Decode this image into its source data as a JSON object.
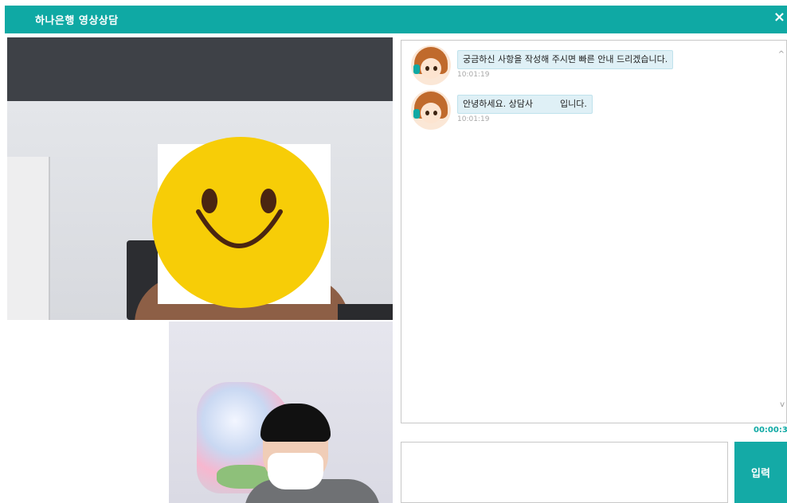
{
  "window": {
    "title": "하나은행 영상상담",
    "close_glyph": "×",
    "accent_color": "#0fa9a4"
  },
  "videos": {
    "remote_label": "",
    "local_label": ""
  },
  "chat": {
    "messages": [
      {
        "sender": "counselor",
        "text_before": "궁금하신 사항을 작성해 주시면 빠른 안내 드리겠습니다.",
        "text_after": "",
        "time": "10:01:19"
      },
      {
        "sender": "counselor",
        "text_before": "안녕하세요. 상담사",
        "text_after": "입니다.",
        "time": "10:01:19"
      }
    ],
    "scroll_up_glyph": "^",
    "scroll_down_glyph": "v",
    "elapsed_timer": "00:00:3"
  },
  "input": {
    "value": "",
    "placeholder": ""
  },
  "send_button": {
    "label": "입력"
  }
}
